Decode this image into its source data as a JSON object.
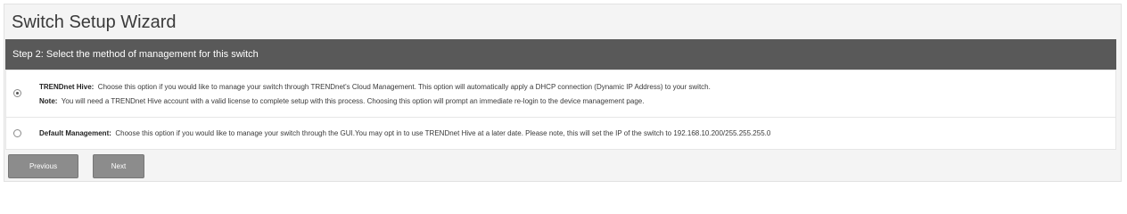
{
  "wizard": {
    "title": "Switch Setup Wizard",
    "step_heading": "Step 2: Select the method of management for this switch"
  },
  "options": {
    "hive": {
      "label": "TRENDnet Hive:",
      "description": "Choose this option if you would like to manage your switch through TRENDnet's Cloud Management. This option will automatically apply a DHCP connection (Dynamic IP Address) to your switch.",
      "note_label": "Note:",
      "note_text": "You will need a TRENDnet Hive account with a valid license to complete setup with this process. Choosing this option will prompt an immediate re-login to the device management page.",
      "selected": true
    },
    "default": {
      "label": "Default Management:",
      "description": "Choose this option if you would like to manage your switch through the GUI.You may opt in to use TRENDnet Hive at a later date. Please note, this will set the IP of the switch to 192.168.10.200/255.255.255.0",
      "selected": false
    }
  },
  "buttons": {
    "previous_label": "Previous",
    "next_label": "Next"
  },
  "colors": {
    "step_bar": "#595959",
    "button": "#8c8c8c"
  }
}
